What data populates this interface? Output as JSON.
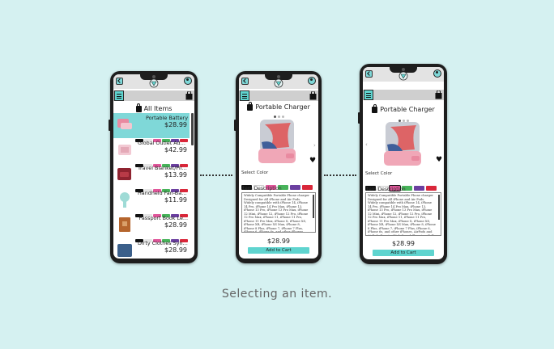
{
  "caption": "Selecting an item.",
  "colors": {
    "background": "#d5f1f1",
    "accent": "#5fd4cf",
    "selected_row": "#7fd8d8"
  },
  "list_screen": {
    "title": "All Items",
    "items": [
      {
        "name": "Portable Battery",
        "price": "$28.99",
        "swatches": [
          "#111111",
          "#e6e6e6",
          "#e0569a",
          "#47b35a",
          "#6b3fa0",
          "#d9273a"
        ]
      },
      {
        "name": "Global Outlet Adap...",
        "price": "$42.99",
        "swatches": [
          "#111111",
          "#e6e6e6",
          "#e0569a",
          "#47b35a",
          "#6b3fa0",
          "#d9273a"
        ]
      },
      {
        "name": "Travel Blanket/Pill...",
        "price": "$13.99",
        "swatches": [
          "#111111",
          "#e6e6e6",
          "#e0569a",
          "#47b35a",
          "#6b3fa0",
          "#d9273a"
        ]
      },
      {
        "name": "Handheld Fan-Batt...",
        "price": "$11.99",
        "swatches": [
          "#111111",
          "#e6e6e6",
          "#e0569a",
          "#47b35a",
          "#6b3fa0",
          "#d9273a"
        ]
      },
      {
        "name": "Passport Book Le...",
        "price": "$28.99",
        "swatches": [
          "#111111",
          "#e6e6e6",
          "#e0569a",
          "#47b35a",
          "#6b3fa0",
          "#d9273a"
        ]
      },
      {
        "name": "Dirty Clothes Sync...",
        "price": "$28.99",
        "swatches": [
          "#111111",
          "#e6e6e6",
          "#e0569a",
          "#47b35a",
          "#6b3fa0",
          "#d9273a"
        ]
      }
    ]
  },
  "detail_screen": {
    "title": "Portable Charger",
    "select_color_label": "Select Color",
    "swatches": [
      "#111111",
      "#ffffff",
      "#e0569a",
      "#47b35a",
      "#6b3fa0",
      "#d9273a"
    ],
    "description_label": "Item Description",
    "description": "Widely Compatible Portable Phone charger Designed for All iPhone and Air Pods. Widely compatible with iPhone 14, iPhone 14 Pro, iPhone 14 Pro Max, iPhone 13, iPhone 13 Pro, iPhone 13 Pro Max, iPhone 12 Mini, iPhone 12, iPhone 12 Pro, iPhone 12 Pro Max, iPhone 11, iPhone 11 Pro, iPhone 11 Pro Max, iPhone X, iPhone XS, iPhone XR, iPhone XS Max, iPhone 8, iPhone 8 Plus, iPhone 7, iPhone 7 Plus, iPhone 6, iPhone 6s, and other iPhones, AirPods and AirPods Pro etc. High-Speed Charging: Fully charges your iPhone in only 1.8 hours, portable charger iphone provides fast charging technology; the power portable charger to your phone smoothly. Safely connects to your device, making this charger iphone portable an ideal choice for travel, commute or other everyday situations. 5000mAh Capacity: Most iPhones can be fully charged in half once; the capacity is enough for emergency use when going out. Store your charger in your purse and just connect to charge on the go.",
    "price": "$28.99",
    "add_to_cart": "Add to Cart"
  }
}
